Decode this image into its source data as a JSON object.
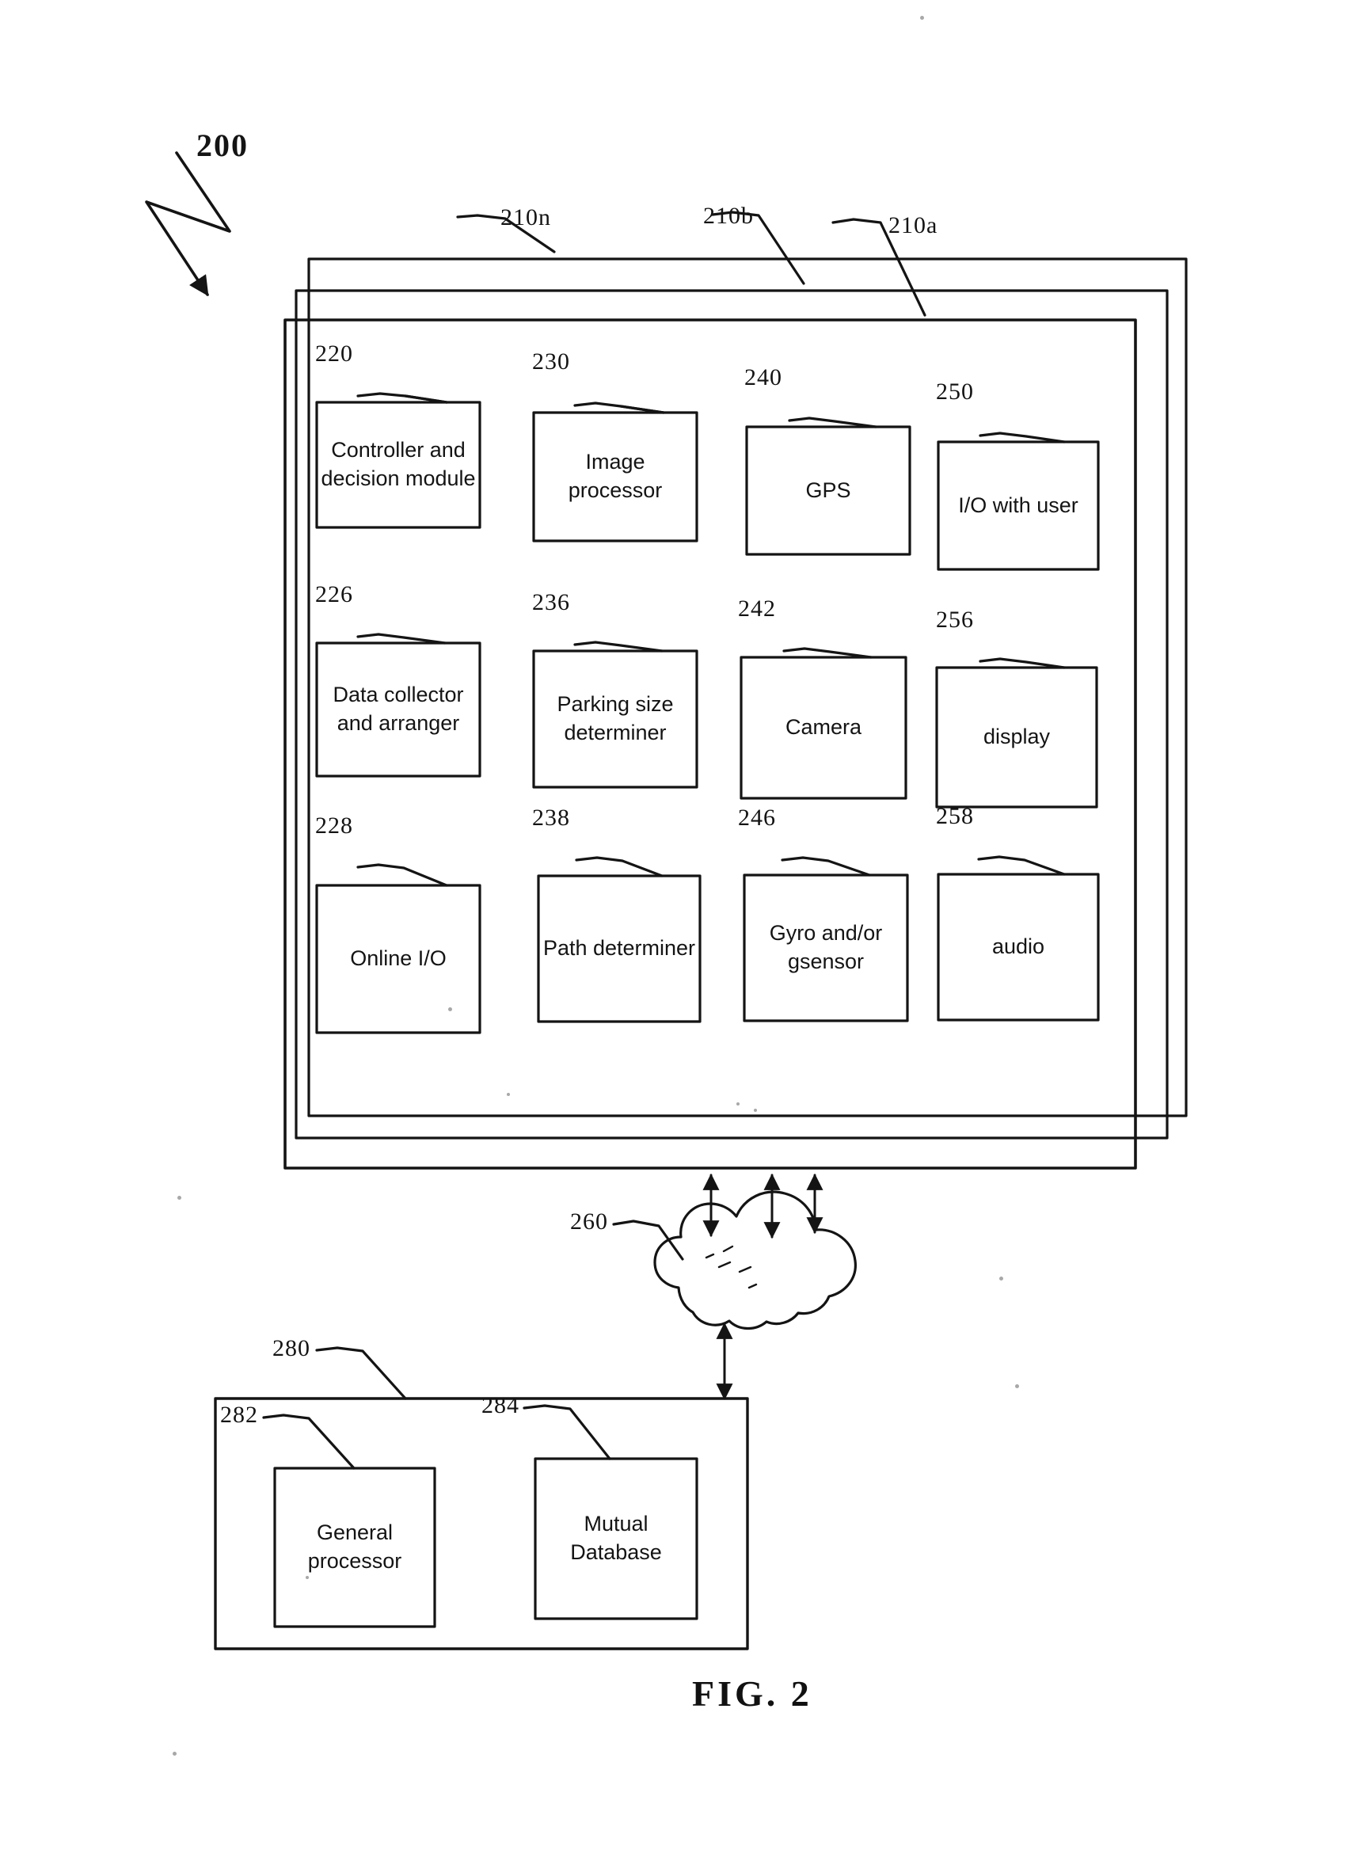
{
  "figure": {
    "caption": "FIG. 2",
    "system_ref": "200"
  },
  "panels": [
    {
      "ref": "210n"
    },
    {
      "ref": "210b"
    },
    {
      "ref": "210a"
    }
  ],
  "modules": [
    {
      "ref": "220",
      "label": "Controller and decision module"
    },
    {
      "ref": "230",
      "label": "Image processor"
    },
    {
      "ref": "240",
      "label": "GPS"
    },
    {
      "ref": "250",
      "label": "I/O with user"
    },
    {
      "ref": "226",
      "label": "Data collector and arranger"
    },
    {
      "ref": "236",
      "label": "Parking size determiner"
    },
    {
      "ref": "242",
      "label": "Camera"
    },
    {
      "ref": "256",
      "label": "display"
    },
    {
      "ref": "228",
      "label": "Online I/O"
    },
    {
      "ref": "238",
      "label": "Path determiner"
    },
    {
      "ref": "246",
      "label": "Gyro and/or gsensor"
    },
    {
      "ref": "258",
      "label": "audio"
    }
  ],
  "network": {
    "ref": "260",
    "name": "cloud"
  },
  "server": {
    "ref": "280",
    "children": [
      {
        "ref": "282",
        "label": "General processor"
      },
      {
        "ref": "284",
        "label": "Mutual Database"
      }
    ]
  },
  "colors": {
    "ink": "#141414",
    "paper": "#ffffff"
  }
}
